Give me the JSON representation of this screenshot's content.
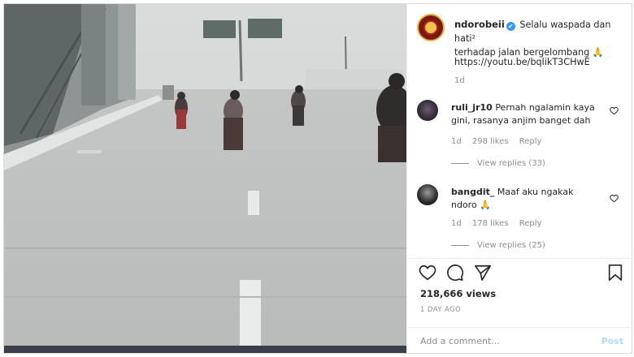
{
  "post": {
    "username": "ndorobeii",
    "verified_mark": "✔",
    "caption_line1": "Selalu waspada dan hati²",
    "caption_line2": "terhadap jalan bergelombang 🙏",
    "link": "https://youtu.be/bqlikT3CHwE",
    "time": "1d"
  },
  "comments": [
    {
      "username": "ruli_jr10",
      "text": "Pernah ngalamin kaya gini, rasanya anjim banget dah",
      "time": "1d",
      "likes": "298 likes",
      "reply": "Reply",
      "view_replies": "View replies (33)"
    },
    {
      "username": "bangdit_",
      "text": "Maaf aku ngakak ndoro 🙏",
      "time": "1d",
      "likes": "178 likes",
      "reply": "Reply",
      "view_replies": "View replies (25)"
    }
  ],
  "footer": {
    "views": "218,666 views",
    "ago": "1 DAY AGO",
    "add_comment_placeholder": "Add a comment...",
    "post_label": "Post"
  },
  "icons": {
    "like": "heart-icon",
    "comment": "comment-icon",
    "share": "share-icon",
    "save": "bookmark-icon"
  },
  "colors": {
    "verified": "#3897f0",
    "post_disabled": "#b3dbff",
    "muted": "#8e8e8e"
  }
}
